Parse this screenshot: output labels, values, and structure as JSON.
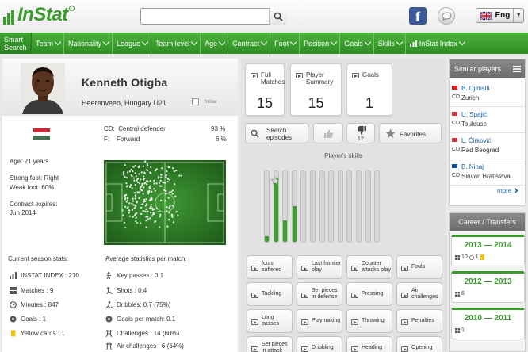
{
  "header": {
    "logo_text": "InStat",
    "search": {
      "value": "",
      "placeholder": ""
    },
    "language": "Eng"
  },
  "nav": {
    "smart_search": "Smart Search",
    "items": [
      "Team",
      "Nationality",
      "League",
      "Team level",
      "Age",
      "Contract",
      "Foot",
      "Position",
      "Goals",
      "Skills",
      "InStat Index"
    ]
  },
  "player": {
    "name": "Kenneth Otigba",
    "club": "Heerenveen, Hungary U21",
    "follow_label": "follow",
    "positions": [
      {
        "code": "CD:",
        "name": "Central defender",
        "pct": "93 %"
      },
      {
        "code": "F:",
        "name": "Forward",
        "pct": "6 %"
      }
    ],
    "age": "Age: 21 years",
    "strong_foot": "Strong foot: Right",
    "weak_foot": "Weak foot: 60%",
    "contract_label": "Contract expires:",
    "contract_value": "Jun 2014"
  },
  "season_stats": {
    "title": "Current season stats:",
    "rows": [
      {
        "icon": "bar-chart-icon",
        "text": "INSTAT INDEX : 210"
      },
      {
        "icon": "grid-icon",
        "text": "Matches : 9"
      },
      {
        "icon": "clock-icon",
        "text": "Minutes : 847"
      },
      {
        "icon": "ball-icon",
        "text": "Goals : 1"
      },
      {
        "icon": "card-icon",
        "text": "Yellow cards : 1"
      }
    ]
  },
  "avg_stats": {
    "title": "Average statistics per match:",
    "rows": [
      {
        "icon": "pass-icon",
        "text": "Key passes : 0.1"
      },
      {
        "icon": "shot-icon",
        "text": "Shots : 0.4"
      },
      {
        "icon": "dribble-icon",
        "text": "Dribbles: 0.7 (75%)"
      },
      {
        "icon": "goal-icon",
        "text": "Goals per match: 0.1"
      },
      {
        "icon": "tackle-icon",
        "text": "Challenges : 14 (60%)"
      },
      {
        "icon": "air-icon",
        "text": "Air challenges : 6 (64%)"
      }
    ]
  },
  "cards": [
    {
      "label": "Full Matches",
      "value": "15"
    },
    {
      "label": "Player Summary",
      "value": "15"
    },
    {
      "label": "Goals",
      "value": "1"
    }
  ],
  "actions": {
    "search_episodes": "Search episodes",
    "dislike_count": "12",
    "favorites": "Favorites"
  },
  "skills": {
    "title": "Player's skills",
    "levels": [
      0.08,
      0.91,
      0.3,
      0.51,
      0,
      0,
      0,
      0,
      0,
      0,
      0,
      0,
      0
    ],
    "buttons": [
      "fouls suffered",
      "Last frontier play",
      "Counter attacks play",
      "Fouls",
      "Tackling",
      "Set pieces in defense",
      "Pressing",
      "Air challenges",
      "Long passes",
      "Playmaking",
      "Throwing",
      "Penalties",
      "Set pieces in attack",
      "Dribbling",
      "Heading",
      "Opening"
    ]
  },
  "similar": {
    "title": "Similar players",
    "items": [
      {
        "pos": "CD",
        "name": "B. Djimsiti",
        "club": "Zurich"
      },
      {
        "pos": "CD",
        "name": "U. Spajić",
        "club": "Toulouse"
      },
      {
        "pos": "CD",
        "name": "L. Ćirković",
        "club": "Rad Beograd"
      },
      {
        "pos": "CD",
        "name": "B. Ninaj",
        "club": "Slovan Bratislava"
      }
    ],
    "more": "more"
  },
  "career": {
    "title": "Career / Transfers",
    "entries": [
      {
        "years": "2013 — 2014",
        "stats": "10",
        "stats2": "1"
      },
      {
        "years": "2012 — 2013",
        "stats": "6"
      },
      {
        "years": "2010 — 2011",
        "stats": "1"
      }
    ]
  },
  "colors": {
    "brand_green": "#3a9b2c",
    "nav_green": "#3fa532",
    "facebook": "#3b5998"
  }
}
